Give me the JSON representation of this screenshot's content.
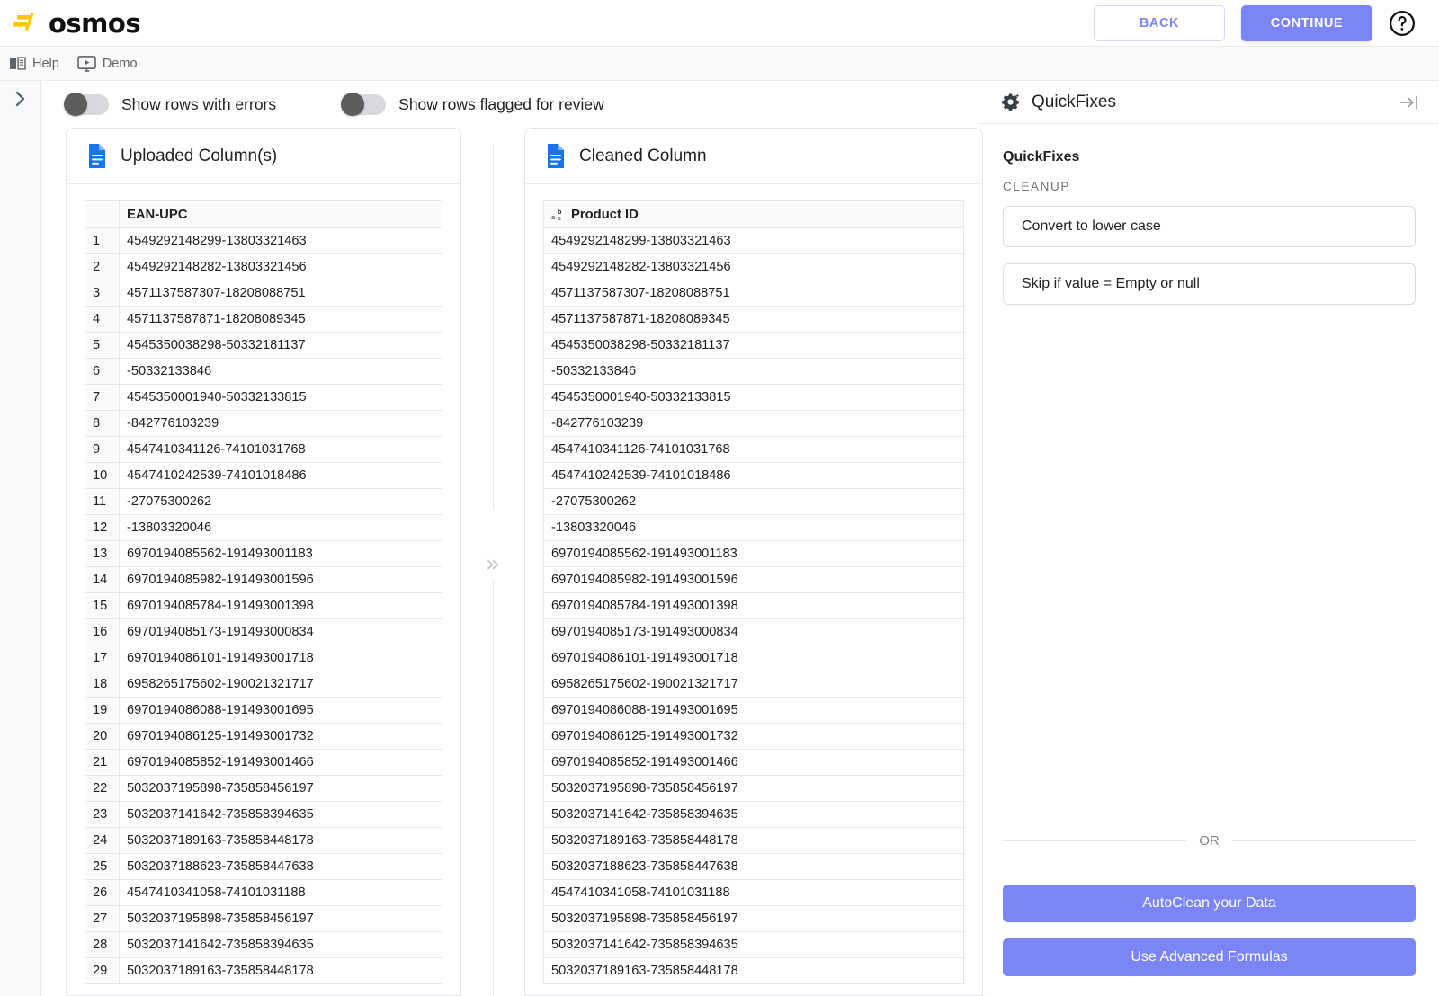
{
  "topbar": {
    "logo_text": "osmos",
    "back_label": "BACK",
    "continue_label": "CONTINUE"
  },
  "subbar": {
    "items": [
      {
        "label": "Help",
        "icon": "book-icon"
      },
      {
        "label": "Demo",
        "icon": "play-monitor-icon"
      }
    ]
  },
  "filters": {
    "toggles": [
      {
        "label": "Show rows with errors",
        "on": false
      },
      {
        "label": "Show rows flagged for review",
        "on": false
      }
    ]
  },
  "uploaded_panel": {
    "title": "Uploaded Column(s)",
    "icon": "file-icon",
    "row_header": "",
    "column_header": "EAN-UPC",
    "rows": [
      {
        "n": "1",
        "value": "4549292148299-13803321463"
      },
      {
        "n": "2",
        "value": "4549292148282-13803321456"
      },
      {
        "n": "3",
        "value": "4571137587307-18208088751"
      },
      {
        "n": "4",
        "value": "4571137587871-18208089345"
      },
      {
        "n": "5",
        "value": "4545350038298-50332181137"
      },
      {
        "n": "6",
        "value": "-50332133846"
      },
      {
        "n": "7",
        "value": "4545350001940-50332133815"
      },
      {
        "n": "8",
        "value": "-842776103239"
      },
      {
        "n": "9",
        "value": "4547410341126-74101031768"
      },
      {
        "n": "10",
        "value": "4547410242539-74101018486"
      },
      {
        "n": "11",
        "value": "-27075300262"
      },
      {
        "n": "12",
        "value": "-13803320046"
      },
      {
        "n": "13",
        "value": "6970194085562-191493001183"
      },
      {
        "n": "14",
        "value": "6970194085982-191493001596"
      },
      {
        "n": "15",
        "value": "6970194085784-191493001398"
      },
      {
        "n": "16",
        "value": "6970194085173-191493000834"
      },
      {
        "n": "17",
        "value": "6970194086101-191493001718"
      },
      {
        "n": "18",
        "value": "6958265175602-190021321717"
      },
      {
        "n": "19",
        "value": "6970194086088-191493001695"
      },
      {
        "n": "20",
        "value": "6970194086125-191493001732"
      },
      {
        "n": "21",
        "value": "6970194085852-191493001466"
      },
      {
        "n": "22",
        "value": "5032037195898-735858456197"
      },
      {
        "n": "23",
        "value": "5032037141642-735858394635"
      },
      {
        "n": "24",
        "value": "5032037189163-735858448178"
      },
      {
        "n": "25",
        "value": "5032037188623-735858447638"
      },
      {
        "n": "26",
        "value": "4547410341058-74101031188"
      },
      {
        "n": "27",
        "value": "5032037195898-735858456197"
      },
      {
        "n": "28",
        "value": "5032037141642-735858394635"
      },
      {
        "n": "29",
        "value": "5032037189163-735858448178"
      }
    ]
  },
  "cleaned_panel": {
    "title": "Cleaned Column",
    "icon": "file-icon",
    "column_header": "Product ID",
    "column_header_icon": "abc-text-type-icon",
    "rows": [
      {
        "value": "4549292148299-13803321463"
      },
      {
        "value": "4549292148282-13803321456"
      },
      {
        "value": "4571137587307-18208088751"
      },
      {
        "value": "4571137587871-18208089345"
      },
      {
        "value": "4545350038298-50332181137"
      },
      {
        "value": "-50332133846"
      },
      {
        "value": "4545350001940-50332133815"
      },
      {
        "value": "-842776103239"
      },
      {
        "value": "4547410341126-74101031768"
      },
      {
        "value": "4547410242539-74101018486"
      },
      {
        "value": "-27075300262"
      },
      {
        "value": "-13803320046"
      },
      {
        "value": "6970194085562-191493001183"
      },
      {
        "value": "6970194085982-191493001596"
      },
      {
        "value": "6970194085784-191493001398"
      },
      {
        "value": "6970194085173-191493000834"
      },
      {
        "value": "6970194086101-191493001718"
      },
      {
        "value": "6958265175602-190021321717"
      },
      {
        "value": "6970194086088-191493001695"
      },
      {
        "value": "6970194086125-191493001732"
      },
      {
        "value": "6970194085852-191493001466"
      },
      {
        "value": "5032037195898-735858456197"
      },
      {
        "value": "5032037141642-735858394635"
      },
      {
        "value": "5032037189163-735858448178"
      },
      {
        "value": "5032037188623-735858447638"
      },
      {
        "value": "4547410341058-74101031188"
      },
      {
        "value": "5032037195898-735858456197"
      },
      {
        "value": "5032037141642-735858394635"
      },
      {
        "value": "5032037189163-735858448178"
      }
    ]
  },
  "quickfixes": {
    "header_title": "QuickFixes",
    "header_icon": "gear-sparkle-icon",
    "collapse_icon": "collapse-right-icon",
    "section_title": "QuickFixes",
    "group_label": "CLEANUP",
    "chips": [
      "Convert to lower case",
      "Skip if value = Empty or null"
    ],
    "or_label": "OR",
    "autoclean_label": "AutoClean your Data",
    "formulas_label": "Use Advanced Formulas"
  },
  "colors": {
    "accent_purple": "#7b85f5",
    "logo_yellow": "#ffc800",
    "file_icon_blue": "#1a73e8",
    "toggle_knob": "#5c5c5c"
  }
}
